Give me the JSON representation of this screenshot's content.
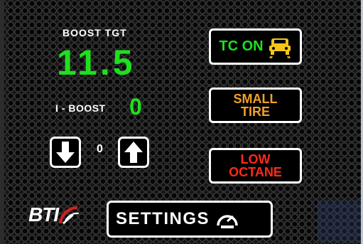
{
  "boost_target": {
    "label": "BOOST TGT",
    "value": "11.5"
  },
  "i_boost": {
    "label": "I - BOOST",
    "value": "0"
  },
  "stepper": {
    "value": "0",
    "decrease_icon": "arrow-down-icon",
    "increase_icon": "arrow-up-icon"
  },
  "status_buttons": {
    "traction_control": {
      "label": "TC ON",
      "icon": "traction-control-car-icon",
      "color": "#1ee01e"
    },
    "small_tire": {
      "line1": "SMALL",
      "line2": "TIRE",
      "color": "#f0a028"
    },
    "low_octane": {
      "line1": "LOW",
      "line2": "OCTANE",
      "color": "#ff2a1a"
    }
  },
  "logo": {
    "text": "BTI",
    "icon": "gauge-swoosh-icon"
  },
  "settings": {
    "label": "SETTINGS",
    "icon": "speedometer-icon"
  },
  "colors": {
    "accent_green": "#1ee01e",
    "warning_orange": "#f0a028",
    "alert_red": "#ff2a1a",
    "text_white": "#ffffff"
  }
}
